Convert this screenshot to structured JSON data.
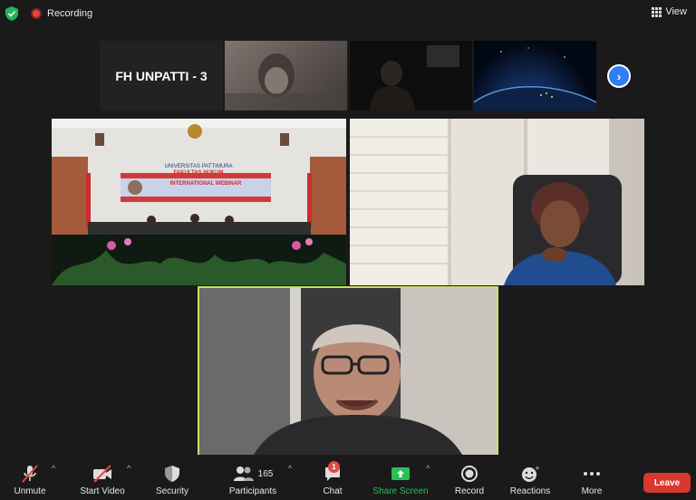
{
  "top_bar": {
    "recording_label": "Recording",
    "view_label": "View",
    "icons": [
      "shield-icon",
      "recording-icon",
      "grid-icon"
    ]
  },
  "filmstrip": {
    "name_tile": "FH UNPATTI - 3",
    "next_icon": "chevron-right-icon"
  },
  "banner": {
    "line1": "UNIVERSITAS PATTIMURA",
    "line2": "FAKULTAS HUKUM",
    "line3": "INTERNATIONAL WEBINAR"
  },
  "toolbar": {
    "unmute": "Unmute",
    "start_video": "Start Video",
    "security": "Security",
    "participants": "Participants",
    "participant_count": "165",
    "chat": "Chat",
    "chat_badge": "1",
    "share_screen": "Share Screen",
    "record": "Record",
    "reactions": "Reactions",
    "more": "More",
    "leave": "Leave"
  },
  "colors": {
    "accent": "#2f7ef3",
    "active_speaker_border": "#c7e35a",
    "leave": "#d9382f",
    "share": "#2dbf57",
    "recording": "#e0483f"
  }
}
